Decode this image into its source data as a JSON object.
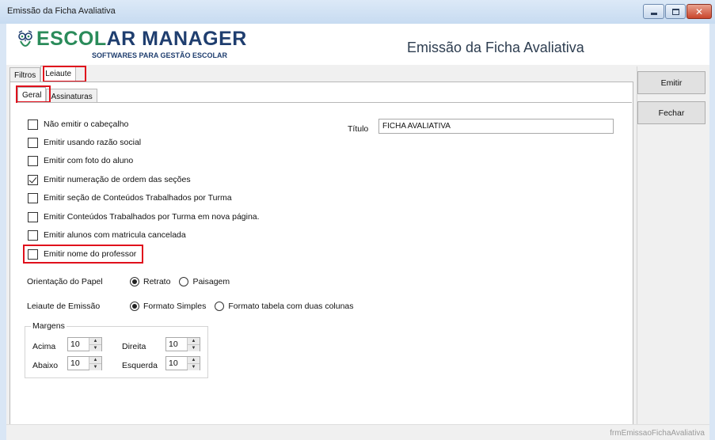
{
  "window": {
    "title": "Emissão da Ficha Avaliativa",
    "controls": [
      "minimize-icon",
      "maximize-icon",
      "close-icon"
    ]
  },
  "header": {
    "logo_part1": "ESCOL",
    "logo_part2": "AR MANAGER",
    "logo_subtitle": "SOFTWARES PARA GESTÃO ESCOLAR",
    "title": "Emissão da Ficha Avaliativa"
  },
  "tabs_outer": [
    {
      "label": "Filtros",
      "active": false
    },
    {
      "label": "Leiaute",
      "active": true
    }
  ],
  "tabs_inner": [
    {
      "label": "Geral",
      "active": true
    },
    {
      "label": "Assinaturas",
      "active": false
    }
  ],
  "options": [
    {
      "label": "Não emitir o cabeçalho",
      "checked": false
    },
    {
      "label": "Emitir usando razão social",
      "checked": false
    },
    {
      "label": "Emitir com foto do aluno",
      "checked": false
    },
    {
      "label": "Emitir numeração de ordem das seções",
      "checked": true
    },
    {
      "label": "Emitir seção de Conteúdos Trabalhados por Turma",
      "checked": false
    },
    {
      "label": "Emitir Conteúdos Trabalhados por Turma em nova página.",
      "checked": false
    },
    {
      "label": "Emitir alunos com matricula cancelada",
      "checked": false
    },
    {
      "label": "Emitir nome do professor",
      "checked": false
    }
  ],
  "titulo": {
    "label": "Título",
    "value": "FICHA AVALIATIVA"
  },
  "orientacao": {
    "label": "Orientação do Papel",
    "options": [
      {
        "label": "Retrato",
        "checked": true
      },
      {
        "label": "Paisagem",
        "checked": false
      }
    ]
  },
  "leiaute_emissao": {
    "label": "Leiaute de Emissão",
    "options": [
      {
        "label": "Formato Simples",
        "checked": true
      },
      {
        "label": "Formato tabela com duas colunas",
        "checked": false
      }
    ]
  },
  "margens": {
    "title": "Margens",
    "acima_label": "Acima",
    "acima_value": "10",
    "abaixo_label": "Abaixo",
    "abaixo_value": "10",
    "direita_label": "Direita",
    "direita_value": "10",
    "esquerda_label": "Esquerda",
    "esquerda_value": "10"
  },
  "buttons": {
    "emitir": "Emitir",
    "fechar": "Fechar"
  },
  "status": {
    "form_name": "frmEmissaoFichaAvaliativa"
  },
  "colors": {
    "highlight": "#e0101c",
    "logo_green": "#2a8b5a",
    "logo_blue": "#1f3e6f"
  }
}
